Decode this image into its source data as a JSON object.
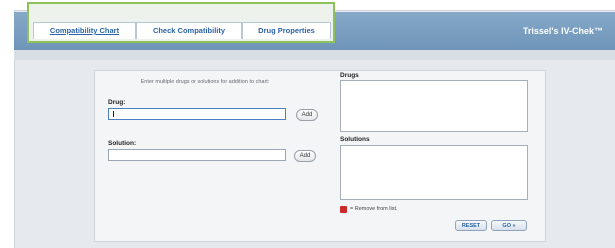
{
  "app": {
    "brand": "Trissel's IV-Chek™"
  },
  "tabs": [
    {
      "label": "Compatibility Chart"
    },
    {
      "label": "Check Compatibility"
    },
    {
      "label": "Drug Properties"
    }
  ],
  "form": {
    "instruction": "Enter multiple drugs or solutions for addition to chart:",
    "drug_label": "Drug:",
    "drug_value": "",
    "solution_label": "Solution:",
    "solution_value": "",
    "add_label": "Add"
  },
  "lists": {
    "drugs_label": "Drugs",
    "solutions_label": "Solutions"
  },
  "legend": {
    "text": "= Remove from list.",
    "icon": "remove-icon",
    "color": "#cc2b2b"
  },
  "actions": {
    "reset_label": "RESET",
    "go_label": "GO »"
  },
  "colors": {
    "header": "#7a9ec2",
    "highlight": "#8dc15a",
    "tab_text": "#2b63a8"
  }
}
